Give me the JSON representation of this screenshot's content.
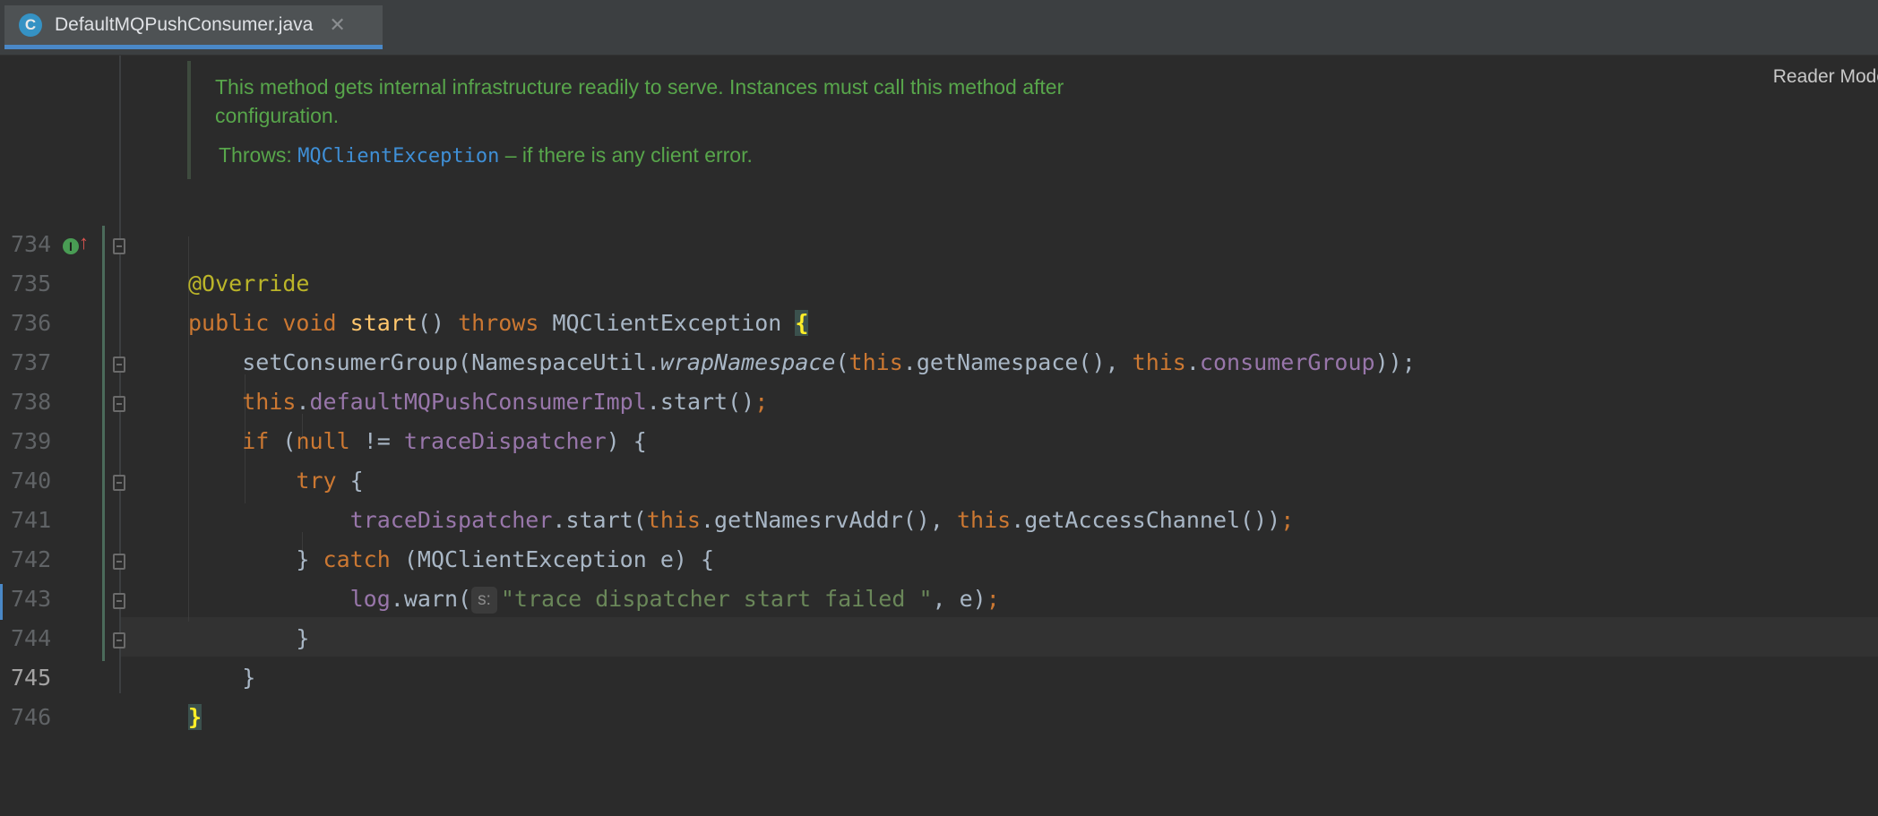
{
  "tab": {
    "icon_letter": "C",
    "title": "DefaultMQPushConsumer.java",
    "close_glyph": "✕"
  },
  "reader_mode": "Reader Mode",
  "doc": {
    "line1": "This method gets internal infrastructure readily to serve. Instances must call this method after",
    "line2": "configuration.",
    "throws_label": "Throws: ",
    "throws_link": "MQClientException",
    "throws_desc": " – if there is any client error."
  },
  "gutter_icons": {
    "override": "I",
    "arrow": "↑"
  },
  "inlay_hint": "s:",
  "lines": [
    {
      "num": "734"
    },
    {
      "num": "735"
    },
    {
      "num": "736"
    },
    {
      "num": "737"
    },
    {
      "num": "738"
    },
    {
      "num": "739"
    },
    {
      "num": "740"
    },
    {
      "num": "741"
    },
    {
      "num": "742"
    },
    {
      "num": "743"
    },
    {
      "num": "744"
    },
    {
      "num": "745"
    },
    {
      "num": "746"
    }
  ],
  "code": {
    "l734": {
      "annotation": "@Override"
    },
    "l735": {
      "kw1": "public",
      "kw2": "void",
      "method": "start",
      "paren": "() ",
      "kw3": "throws",
      "exc": " MQClientException ",
      "brace": "{"
    },
    "l736": {
      "call": "setConsumerGroup(NamespaceUtil.",
      "static_call": "wrapNamespace",
      "open": "(",
      "this1": "this",
      "mid": ".getNamespace(), ",
      "this2": "this",
      "dot": ".",
      "field": "consumerGroup",
      "close": "));"
    },
    "l737": {
      "this": "this",
      "dot": ".",
      "field": "defaultMQPushConsumerImpl",
      "rest": ".start()",
      "semi": ";"
    },
    "l738": {
      "kw": "if",
      "open": " (",
      "null": "null",
      "op": " != ",
      "field": "traceDispatcher",
      "close": ") {"
    },
    "l739": {
      "kw": "try",
      "rest": " {"
    },
    "l740": {
      "field": "traceDispatcher",
      "call": ".start(",
      "this1": "this",
      "mid": ".getNamesrvAddr(), ",
      "this2": "this",
      "rest": ".getAccessChannel())",
      "semi": ";"
    },
    "l741": {
      "brace": "} ",
      "kw": "catch",
      "rest": " (MQClientException e) {"
    },
    "l742": {
      "field": "log",
      "call": ".warn(",
      "str": "\"trace dispatcher start failed \"",
      "rest": ", e)",
      "semi": ";"
    },
    "l743": {
      "brace": "}"
    },
    "l744": {
      "brace": "}"
    },
    "l745": {
      "brace": "}"
    }
  }
}
